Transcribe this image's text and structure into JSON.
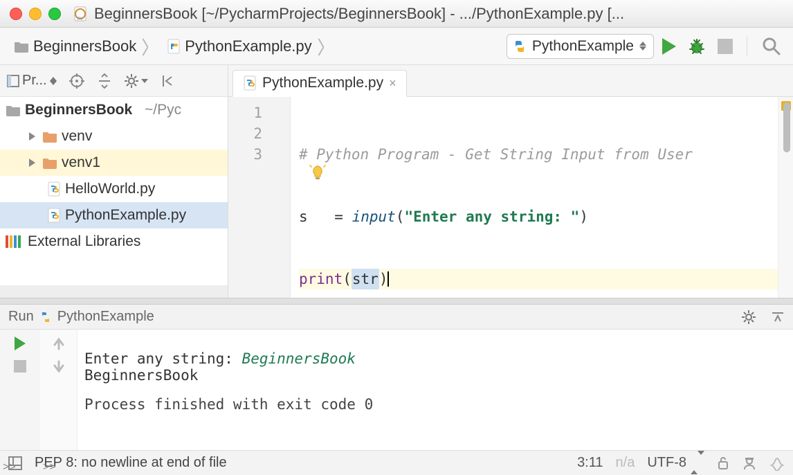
{
  "window": {
    "title": "BeginnersBook [~/PycharmProjects/BeginnersBook] - .../PythonExample.py [..."
  },
  "breadcrumbs": {
    "root": "BeginnersBook",
    "file": "PythonExample.py"
  },
  "run_config": {
    "label": "PythonExample"
  },
  "project_tool": {
    "combo_label": "Pr..."
  },
  "project_tree": {
    "root_name": "BeginnersBook",
    "root_path": "~/Pyc",
    "items": [
      {
        "name": "venv"
      },
      {
        "name": "venv1"
      },
      {
        "name": "HelloWorld.py"
      },
      {
        "name": "PythonExample.py"
      }
    ],
    "external_libs": "External Libraries"
  },
  "editor": {
    "tab": "PythonExample.py",
    "close": "×",
    "gutter": [
      "1",
      "2",
      "3"
    ],
    "code": {
      "comment": "# Python Program - Get String Input from User",
      "l2_pre": "s",
      "l2_post": " = ",
      "l2_var_tail": "",
      "l2_func": "input",
      "l2_open": "(",
      "l2_str": "\"Enter any string: \"",
      "l2_close": ")",
      "l3_func": "print",
      "l3_open": "(",
      "l3_arg": "str",
      "l3_close": ")"
    }
  },
  "run_tool": {
    "title": "Run",
    "name": "PythonExample",
    "console": {
      "prompt": "Enter any string: ",
      "input": "BeginnersBook",
      "echo": "BeginnersBook",
      "exit": "Process finished with exit code 0"
    },
    "hide1": ">>",
    "hide2": ">>"
  },
  "status": {
    "pep": "PEP 8: no newline at end of file",
    "pos": "3:11",
    "na": "n/a",
    "encoding": "UTF-8"
  }
}
